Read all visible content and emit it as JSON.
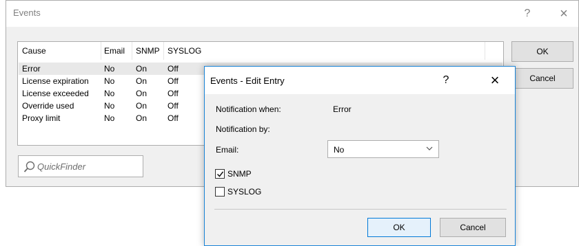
{
  "events_window": {
    "title": "Events",
    "help_label": "?",
    "close_label": "×",
    "columns": [
      "Cause",
      "Email",
      "SNMP",
      "SYSLOG"
    ],
    "rows": [
      [
        "Error",
        "No",
        "On",
        "Off"
      ],
      [
        "License expiration",
        "No",
        "On",
        "Off"
      ],
      [
        "License exceeded",
        "No",
        "On",
        "Off"
      ],
      [
        "Override used",
        "No",
        "On",
        "Off"
      ],
      [
        "Proxy limit",
        "No",
        "On",
        "Off"
      ]
    ],
    "selected_row": 0,
    "quickfinder_placeholder": "QuickFinder",
    "ok_label": "OK",
    "cancel_label": "Cancel"
  },
  "edit_dialog": {
    "title": "Events - Edit Entry",
    "help_label": "?",
    "close_label": "×",
    "notification_when_label": "Notification when:",
    "notification_when_value": "Error",
    "notification_by_label": "Notification by:",
    "email_label": "Email:",
    "email_value": "No",
    "snmp_label": "SNMP",
    "snmp_checked": true,
    "syslog_label": "SYSLOG",
    "syslog_checked": false,
    "ok_label": "OK",
    "cancel_label": "Cancel"
  }
}
